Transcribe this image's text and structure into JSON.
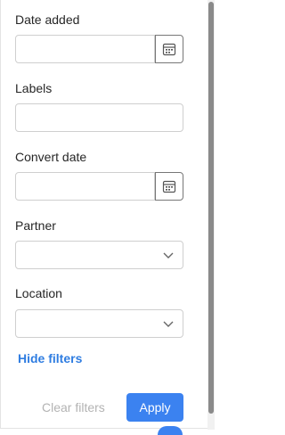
{
  "filters": {
    "date_added": {
      "label": "Date added",
      "value": ""
    },
    "labels": {
      "label": "Labels",
      "value": ""
    },
    "convert_date": {
      "label": "Convert date",
      "value": ""
    },
    "partner": {
      "label": "Partner",
      "selected": ""
    },
    "location": {
      "label": "Location",
      "selected": ""
    }
  },
  "actions": {
    "hide_filters": "Hide filters",
    "clear_filters": "Clear filters",
    "apply": "Apply"
  },
  "colors": {
    "accent": "#3b82f0",
    "link": "#2f7de1",
    "disabled_text": "#b3b3b3"
  },
  "icons": {
    "calendar": "calendar-icon",
    "chevron": "chevron-down-icon"
  }
}
